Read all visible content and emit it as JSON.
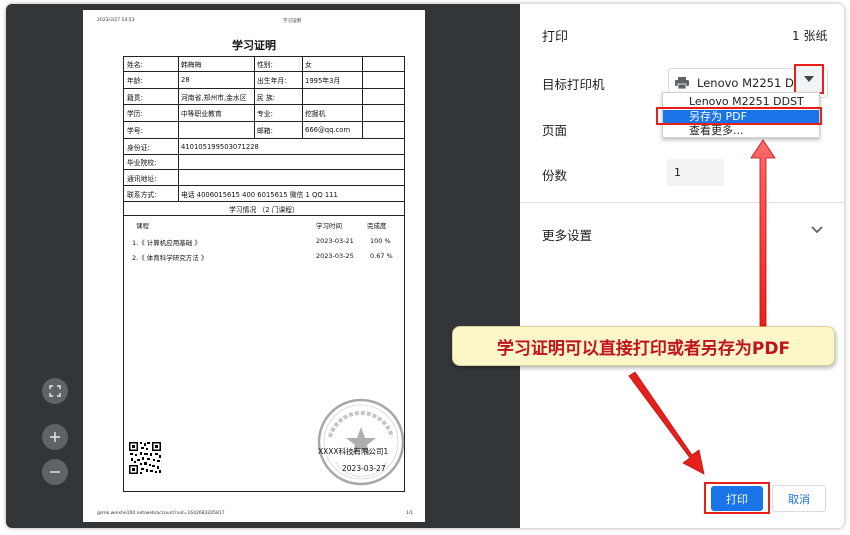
{
  "document": {
    "header_date": "2023/3/27 14:53",
    "header_title": "学习证明",
    "title": "学习证明",
    "fields": {
      "name_label": "姓名:",
      "name_value": "韩梅梅",
      "gender_label": "性别:",
      "gender_value": "女",
      "age_label": "年龄:",
      "age_value": "28",
      "birth_label": "出生年月:",
      "birth_value": "1995年3月",
      "origin_label": "籍贯:",
      "origin_value": "河南省,郑州市,金水区",
      "ethnic_label": "民 族:",
      "ethnic_value": "",
      "edu_label": "学历:",
      "edu_value": "中等职业教育",
      "major_label": "专业:",
      "major_value": "挖掘机",
      "id_label": "学号:",
      "id_value": "",
      "email_label": "邮箱:",
      "email_value": "666@qq.com",
      "idcard_label": "身份证:",
      "idcard_value": "410105199503071228",
      "school_label": "毕业院校:",
      "school_value": "",
      "address_label": "通讯地址:",
      "address_value": "",
      "contact_label": "联系方式:",
      "contact_value": "电话 4006015615    400 6015615  微信 1   QQ 111"
    },
    "study_header": "学习情况 （2 门课程）",
    "course_headers": {
      "course": "课程",
      "time": "学习时间",
      "progress": "完成度"
    },
    "courses": [
      {
        "name": "1.《 计算机应用基础 》",
        "time": "2023-03-21",
        "progress": "100 %"
      },
      {
        "name": "2.《 体育科学研究方法 》",
        "time": "2023-03-25",
        "progress": "0.67 %"
      }
    ],
    "company": "XXXX科技有限公司1",
    "date": "2023-03-27",
    "footer_url": "gsmk.weixhe100.net/web/account?uid=1642683205817",
    "footer_page": "1/1"
  },
  "settings": {
    "title": "打印",
    "sheet_count": "1 张纸",
    "printer_label": "目标打印机",
    "printer_selected": "Lenovo M2251 DDST",
    "printer_options": [
      "Lenovo M2251 DDST",
      "另存为 PDF",
      "查看更多..."
    ],
    "pages_label": "页面",
    "copies_label": "份数",
    "copies_value": "1",
    "more_settings_label": "更多设置",
    "print_button": "打印",
    "cancel_button": "取消"
  },
  "callout": "学习证明可以直接打印或者另存为PDF",
  "colors": {
    "accent": "#1a73e8",
    "highlight": "#e8201b",
    "callout_bg": "#fdf7c7",
    "callout_text": "#c1121f",
    "preview_bg": "#323639"
  },
  "icons": {
    "printer": "printer-icon",
    "dropdown": "triangle-down-icon",
    "expand": "chevron-down-icon",
    "fit": "fit-to-page-icon",
    "zoom_in": "plus-icon",
    "zoom_out": "minus-icon"
  }
}
